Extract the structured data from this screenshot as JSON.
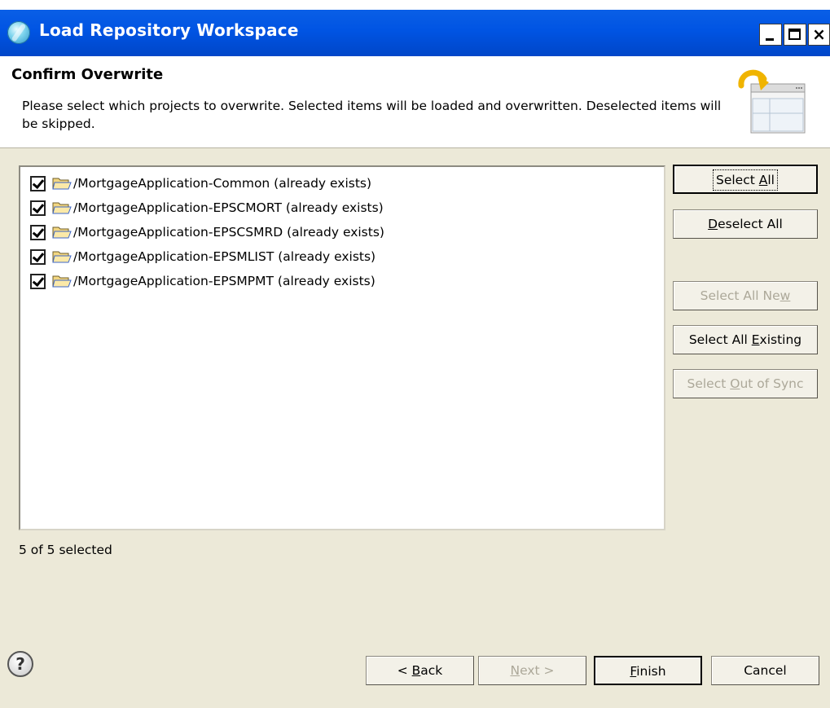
{
  "window": {
    "title": "Load Repository Workspace",
    "close_glyph": "×"
  },
  "banner": {
    "title": "Confirm Overwrite",
    "description": "Please select which projects to overwrite. Selected items will be loaded and overwritten. Deselected items will be skipped."
  },
  "projects": [
    {
      "label": "/MortgageApplication-Common (already exists)",
      "checked": true
    },
    {
      "label": "/MortgageApplication-EPSCMORT (already exists)",
      "checked": true
    },
    {
      "label": "/MortgageApplication-EPSCSMRD (already exists)",
      "checked": true
    },
    {
      "label": "/MortgageApplication-EPSMLIST (already exists)",
      "checked": true
    },
    {
      "label": "/MortgageApplication-EPSMPMT (already exists)",
      "checked": true
    }
  ],
  "side_buttons": {
    "select_all": {
      "before": "Select ",
      "mnemonic": "A",
      "after": "ll",
      "enabled": true
    },
    "deselect_all": {
      "before": "",
      "mnemonic": "D",
      "after": "eselect All",
      "enabled": true
    },
    "select_all_new": {
      "before": "Select All Ne",
      "mnemonic": "w",
      "after": "",
      "enabled": false
    },
    "select_all_existing": {
      "before": "Select All ",
      "mnemonic": "E",
      "after": "xisting",
      "enabled": true
    },
    "select_out_of_sync": {
      "before": "Select ",
      "mnemonic": "O",
      "after": "ut of Sync",
      "enabled": false
    }
  },
  "status": "5 of 5 selected",
  "help_glyph": "?",
  "footer": {
    "back": {
      "before": "< ",
      "mnemonic": "B",
      "after": "ack",
      "enabled": true
    },
    "next": {
      "before": "",
      "mnemonic": "N",
      "after": "ext >",
      "enabled": false
    },
    "finish": {
      "before": "",
      "mnemonic": "F",
      "after": "inish",
      "enabled": true
    },
    "cancel": {
      "label": "Cancel",
      "enabled": true
    }
  },
  "colors": {
    "titlebar": "#0054e3",
    "dialog_bg": "#ece9d8",
    "disabled_text": "#aca899"
  },
  "icons": [
    "app-globe-icon",
    "minimize-icon",
    "maximize-icon",
    "close-icon",
    "wizard-banner-icon",
    "folder-icon",
    "checkbox-checked-icon",
    "help-icon"
  ]
}
